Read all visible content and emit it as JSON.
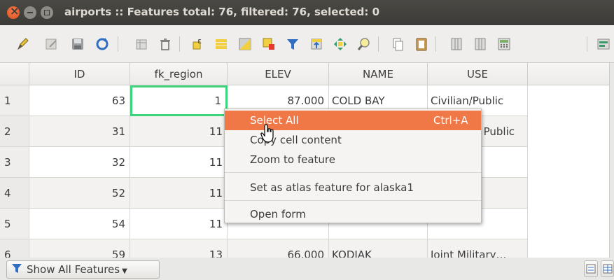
{
  "window": {
    "title": "airports :: Features total: 76, filtered: 76, selected: 0"
  },
  "toolbar": {
    "icons": [
      "edit-pencil-icon",
      "toggle-multiedit-icon",
      "save-edits-icon",
      "reload-icon",
      "add-feature-icon",
      "delete-feature-icon",
      "expression-select-icon",
      "select-all-icon",
      "invert-selection-icon",
      "deselect-icon",
      "filter-select-icon",
      "move-selection-top-icon",
      "pan-to-selection-icon",
      "zoom-to-selection-icon",
      "copy-icon",
      "paste-icon",
      "new-field-icon",
      "delete-field-icon",
      "field-calculator-icon",
      "conditional-format-icon"
    ]
  },
  "table": {
    "columns": [
      "ID",
      "fk_region",
      "ELEV",
      "NAME",
      "USE"
    ],
    "rows": [
      {
        "n": "1",
        "id": "63",
        "fk": "1",
        "elev": "87.000",
        "name": "COLD BAY",
        "use": "Civilian/Public"
      },
      {
        "n": "2",
        "id": "31",
        "fk": "11",
        "elev": "",
        "name": "",
        "use": "Public"
      },
      {
        "n": "3",
        "id": "32",
        "fk": "11",
        "elev": "",
        "name": "",
        "use": ""
      },
      {
        "n": "4",
        "id": "52",
        "fk": "11",
        "elev": "",
        "name": "",
        "use": ""
      },
      {
        "n": "5",
        "id": "54",
        "fk": "11",
        "elev": "",
        "name": "",
        "use": ""
      },
      {
        "n": "6",
        "id": "59",
        "fk": "13",
        "elev": "66.000",
        "name": "KODIAK",
        "use": "Joint Military…"
      }
    ]
  },
  "context_menu": {
    "items": [
      {
        "label": "Select All",
        "shortcut": "Ctrl+A"
      },
      {
        "label": "Copy cell content"
      },
      {
        "label": "Zoom to feature"
      },
      {
        "label": "Set as atlas feature for alaska1"
      },
      {
        "label": "Open form"
      }
    ]
  },
  "status": {
    "filter_label": "Show All Features"
  },
  "colors": {
    "accent": "#f07746",
    "selection": "#3dd47c",
    "titlebar": "#3c3b37"
  }
}
